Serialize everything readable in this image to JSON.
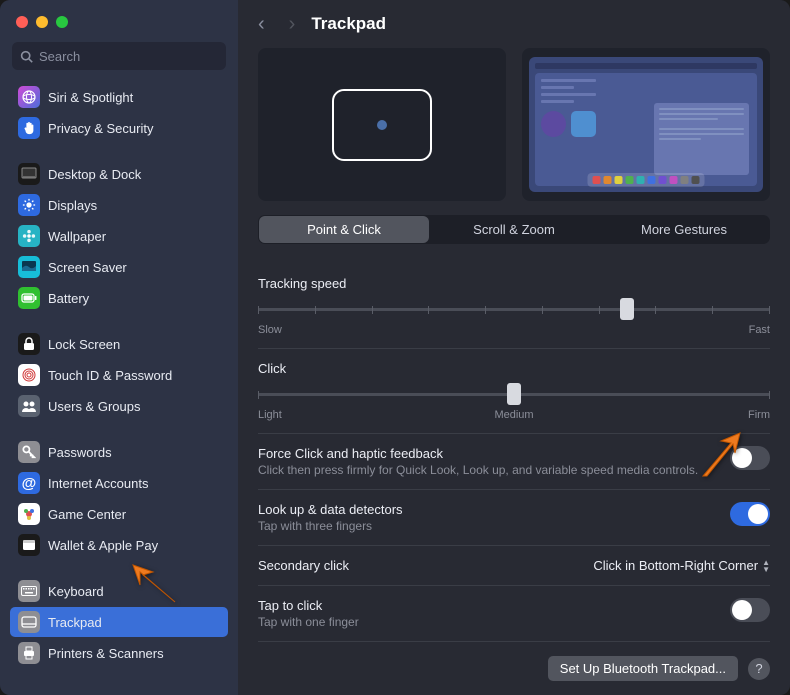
{
  "header": {
    "title": "Trackpad"
  },
  "search": {
    "placeholder": "Search"
  },
  "sidebar": {
    "groups": [
      [
        {
          "label": "Siri & Spotlight",
          "icon_bg": "linear-gradient(135deg,#d04bd8,#4b6dd8)",
          "glyph": "sphere"
        },
        {
          "label": "Privacy & Security",
          "icon_bg": "#2e6ae0",
          "glyph": "hand"
        }
      ],
      [
        {
          "label": "Desktop & Dock",
          "icon_bg": "#1a1a1a",
          "glyph": "dock"
        },
        {
          "label": "Displays",
          "icon_bg": "#2e6ae0",
          "glyph": "sun"
        },
        {
          "label": "Wallpaper",
          "icon_bg": "#27b3c4",
          "glyph": "flower"
        },
        {
          "label": "Screen Saver",
          "icon_bg": "#17bdd8",
          "glyph": "screen"
        },
        {
          "label": "Battery",
          "icon_bg": "#30c030",
          "glyph": "battery"
        }
      ],
      [
        {
          "label": "Lock Screen",
          "icon_bg": "#1a1a1a",
          "glyph": "lock"
        },
        {
          "label": "Touch ID & Password",
          "icon_bg": "#fff",
          "glyph": "finger"
        },
        {
          "label": "Users & Groups",
          "icon_bg": "#5a6270",
          "glyph": "users"
        }
      ],
      [
        {
          "label": "Passwords",
          "icon_bg": "#8e8e93",
          "glyph": "key"
        },
        {
          "label": "Internet Accounts",
          "icon_bg": "#2e6ae0",
          "glyph": "at"
        },
        {
          "label": "Game Center",
          "icon_bg": "#fff",
          "glyph": "game"
        },
        {
          "label": "Wallet & Apple Pay",
          "icon_bg": "#1a1a1a",
          "glyph": "wallet"
        }
      ],
      [
        {
          "label": "Keyboard",
          "icon_bg": "#8e8e93",
          "glyph": "keyboard"
        },
        {
          "label": "Trackpad",
          "icon_bg": "#8e8e93",
          "glyph": "trackpad",
          "selected": true
        },
        {
          "label": "Printers & Scanners",
          "icon_bg": "#8e8e93",
          "glyph": "printer"
        }
      ]
    ]
  },
  "tabs": [
    {
      "label": "Point & Click",
      "active": true
    },
    {
      "label": "Scroll & Zoom"
    },
    {
      "label": "More Gestures"
    }
  ],
  "settings": {
    "tracking": {
      "label": "Tracking speed",
      "min": "Slow",
      "max": "Fast",
      "pos": 0.72
    },
    "click": {
      "label": "Click",
      "left": "Light",
      "mid": "Medium",
      "right": "Firm",
      "pos": 0.5
    },
    "force": {
      "label": "Force Click and haptic feedback",
      "sub": "Click then press firmly for Quick Look, Look up, and variable speed media controls.",
      "on": false
    },
    "lookup": {
      "label": "Look up & data detectors",
      "sub": "Tap with three fingers",
      "on": true
    },
    "secondary": {
      "label": "Secondary click",
      "value": "Click in Bottom-Right Corner"
    },
    "tap": {
      "label": "Tap to click",
      "sub": "Tap with one finger",
      "on": false
    }
  },
  "footer": {
    "btn": "Set Up Bluetooth Trackpad...",
    "help": "?"
  },
  "dock_colors": [
    "#e05050",
    "#e08830",
    "#e0d040",
    "#50b050",
    "#30b0b0",
    "#4070e0",
    "#7050d0",
    "#c050c0",
    "#808080",
    "#505050"
  ]
}
